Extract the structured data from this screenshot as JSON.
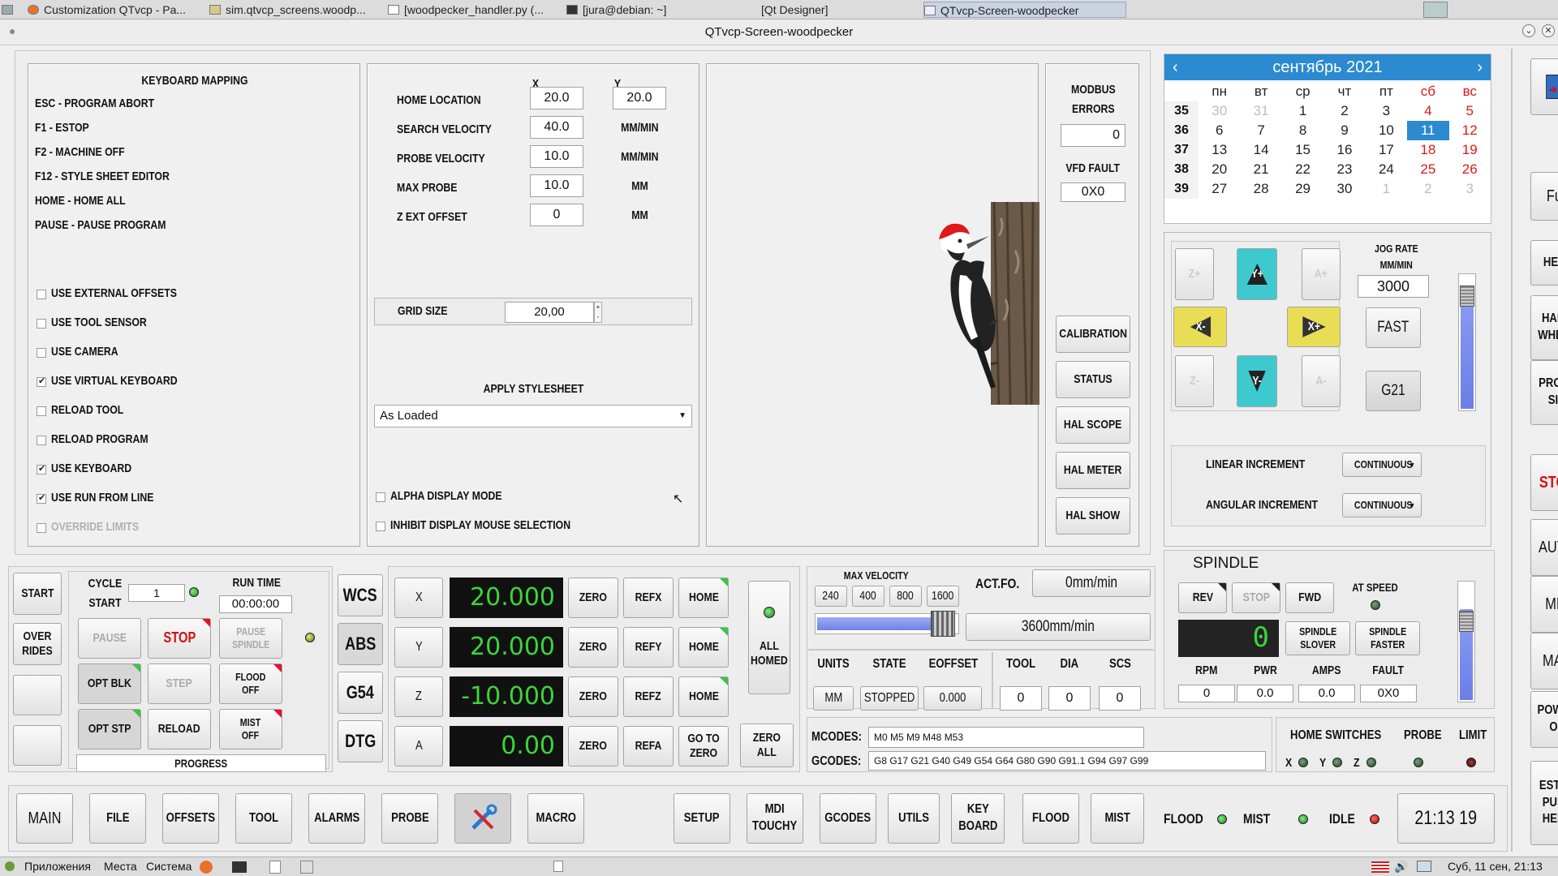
{
  "taskbar": {
    "tabs": [
      "Customization QTvcp - Pa...",
      "sim.qtvcp_screens.woodp...",
      "[woodpecker_handler.py (...",
      "[jura@debian: ~]",
      "[Qt Designer]",
      "QTvcp-Screen-woodpecker"
    ]
  },
  "window": {
    "title": "QTvcp-Screen-woodpecker"
  },
  "keyboard": {
    "title": "KEYBOARD MAPPING",
    "lines": [
      "ESC - PROGRAM ABORT",
      "F1 - ESTOP",
      "F2 - MACHINE OFF",
      "F12 - STYLE SHEET EDITOR",
      "HOME - HOME ALL",
      "PAUSE - PAUSE PROGRAM"
    ]
  },
  "options": [
    {
      "label": "USE EXTERNAL OFFSETS",
      "checked": false
    },
    {
      "label": "USE TOOL SENSOR",
      "checked": false
    },
    {
      "label": "USE CAMERA",
      "checked": false
    },
    {
      "label": "USE VIRTUAL KEYBOARD",
      "checked": true
    },
    {
      "label": "RELOAD TOOL",
      "checked": false
    },
    {
      "label": "RELOAD PROGRAM",
      "checked": false
    },
    {
      "label": "USE KEYBOARD",
      "checked": true
    },
    {
      "label": "USE RUN FROM LINE",
      "checked": true
    },
    {
      "label": "OVERRIDE LIMITS",
      "checked": false
    }
  ],
  "probe_settings": {
    "col_x": "X",
    "col_y": "Y",
    "rows": [
      {
        "label": "HOME LOCATION",
        "x": "20.0",
        "y": "20.0",
        "unit": ""
      },
      {
        "label": "SEARCH VELOCITY",
        "x": "40.0",
        "y": "",
        "unit": "MM/MIN"
      },
      {
        "label": "PROBE VELOCITY",
        "x": "10.0",
        "y": "",
        "unit": "MM/MIN"
      },
      {
        "label": "MAX PROBE",
        "x": "10.0",
        "y": "",
        "unit": "MM"
      },
      {
        "label": "Z EXT OFFSET",
        "x": "0",
        "y": "",
        "unit": "MM"
      }
    ],
    "grid_label": "GRID SIZE",
    "grid_value": "20,00",
    "stylesheet_label": "APPLY STYLESHEET",
    "stylesheet_value": "As Loaded",
    "alpha_label": "ALPHA DISPLAY MODE",
    "inhibit_label": "INHIBIT DISPLAY MOUSE SELECTION"
  },
  "modbus": {
    "title": "MODBUS\nERRORS",
    "errors": "0",
    "vfd_label": "VFD FAULT",
    "vfd_value": "0X0"
  },
  "tools_buttons": [
    "CALIBRATION",
    "STATUS",
    "HAL SCOPE",
    "HAL METER",
    "HAL SHOW"
  ],
  "calendar": {
    "month": "сентябрь",
    "year": "2021",
    "weekdays": [
      "пн",
      "вт",
      "ср",
      "чт",
      "пт",
      "сб",
      "вс"
    ],
    "weeks": [
      {
        "num": "35",
        "days": [
          "30",
          "31",
          "1",
          "2",
          "3",
          "4",
          "5"
        ]
      },
      {
        "num": "36",
        "days": [
          "6",
          "7",
          "8",
          "9",
          "10",
          "11",
          "12"
        ]
      },
      {
        "num": "37",
        "days": [
          "13",
          "14",
          "15",
          "16",
          "17",
          "18",
          "19"
        ]
      },
      {
        "num": "38",
        "days": [
          "20",
          "21",
          "22",
          "23",
          "24",
          "25",
          "26"
        ]
      },
      {
        "num": "39",
        "days": [
          "27",
          "28",
          "29",
          "30",
          "1",
          "2",
          "3"
        ]
      }
    ],
    "selected": "11",
    "accent": "#2b8ad0"
  },
  "jog": {
    "buttons": {
      "z_plus": "Z+",
      "y_plus": "Y+",
      "a_plus": "A+",
      "x_minus": "X-",
      "x_plus": "X+",
      "z_minus": "Z-",
      "y_minus": "Y-",
      "a_minus": "A-"
    },
    "rate_label": "JOG RATE\nMM/MIN",
    "rate_value": "3000",
    "fast": "FAST",
    "units": "G21",
    "linear_label": "LINEAR INCREMENT",
    "linear_value": "CONTINUOUS",
    "angular_label": "ANGULAR INCREMENT",
    "angular_value": "CONTINUOUS"
  },
  "right_buttons": [
    "Full",
    "HELP",
    "HAND\nWHEEL",
    "PROBE\nSIM",
    "STOP",
    "AUTO",
    "MDI",
    "MAN",
    "POWER\nON",
    "ESTOP\nPUSH\nHERE"
  ],
  "run_panel": {
    "start": "START",
    "overrides": "OVER\nRIDES",
    "cycle_start": "CYCLE\nSTART",
    "cycle_count": "1",
    "run_time_label": "RUN TIME",
    "run_time": "00:00:00",
    "pause": "PAUSE",
    "stop": "STOP",
    "pause_spindle": "PAUSE\nSPINDLE",
    "opt_blk": "OPT BLK",
    "step": "STEP",
    "flood_off": "FLOOD\nOFF",
    "opt_stp": "OPT STP",
    "reload": "RELOAD",
    "mist_off": "MIST\nOFF",
    "progress": "PROGRESS"
  },
  "coords": [
    "WCS",
    "ABS",
    "G54",
    "DTG"
  ],
  "dro": [
    {
      "axis": "X",
      "value": "20.000",
      "zero": "ZERO",
      "ref": "REFX",
      "home": "HOME"
    },
    {
      "axis": "Y",
      "value": "20.000",
      "zero": "ZERO",
      "ref": "REFY",
      "home": "HOME"
    },
    {
      "axis": "Z",
      "value": "-10.000",
      "zero": "ZERO",
      "ref": "REFZ",
      "home": "HOME"
    },
    {
      "axis": "A",
      "value": "0.00",
      "zero": "ZERO",
      "ref": "REFA",
      "home": "GO TO\nZERO"
    }
  ],
  "all_homed": "ALL\nHOMED",
  "zero_all": "ZERO\nALL",
  "velocity": {
    "label": "MAX VELOCITY",
    "presets": [
      "240",
      "400",
      "800",
      "1600"
    ],
    "slider_fraction": 0.93,
    "value": "3600mm/min",
    "actfo_label": "ACT.FO.",
    "actfo_value": "0mm/min"
  },
  "status": {
    "headers": [
      "UNITS",
      "STATE",
      "EOFFSET"
    ],
    "values": [
      "MM",
      "STOPPED",
      "0.000"
    ],
    "tool_headers": [
      "TOOL",
      "DIA",
      "SCS"
    ],
    "tool_values": [
      "0",
      "0",
      "0"
    ],
    "mcodes_label": "MCODES:",
    "mcodes": "M0 M5 M9 M48 M53",
    "gcodes_label": "GCODES:",
    "gcodes": "G8 G17 G21 G40 G49 G54 G64 G80 G90 G91.1 G94 G97 G99"
  },
  "spindle": {
    "title": "SPINDLE",
    "rev": "REV",
    "stop": "STOP",
    "fwd": "FWD",
    "at_speed": "AT SPEED",
    "speed": "0",
    "slower": "SPINDLE\nSLOVER",
    "faster": "SPINDLE\nFASTER",
    "headers": [
      "RPM",
      "PWR",
      "AMPS",
      "FAULT"
    ],
    "values": [
      "0",
      "0.0",
      "0.0",
      "0X0"
    ]
  },
  "switches": {
    "title": "HOME SWITCHES",
    "probe": "PROBE",
    "limit": "LIMIT",
    "axes": [
      "X",
      "Y",
      "Z"
    ]
  },
  "nav": [
    "MAIN",
    "FILE",
    "OFFSETS",
    "TOOL",
    "ALARMS",
    "PROBE",
    "",
    "MACRO",
    "SETUP",
    "MDI\nTOUCHY",
    "GCODES",
    "UTILS",
    "KEY\nBOARD",
    "FLOOD",
    "MIST"
  ],
  "indicators": {
    "flood": "FLOOD",
    "mist": "MIST",
    "idle": "IDLE"
  },
  "clock": "21:13 19",
  "bottombar": {
    "apps": "Приложения",
    "places": "Места",
    "system": "Система",
    "datetime": "Суб, 11 сен, 21:13"
  }
}
